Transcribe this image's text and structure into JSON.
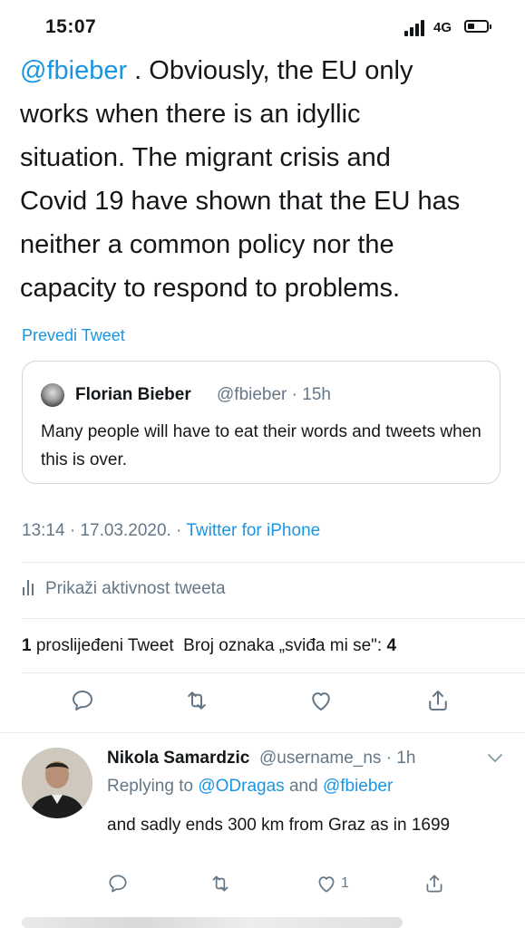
{
  "status_bar": {
    "time": "15:07",
    "network": "4G"
  },
  "tweet": {
    "mention": "@fbieber",
    "text_after_mention": " . Obviously, the EU only",
    "lines": [
      "works when there is an idyllic",
      "situation.  The migrant crisis and",
      "Covid 19 have shown that the EU has",
      "neither a common policy nor the",
      "capacity to respond to problems."
    ],
    "translate_label": "Prevedi Tweet",
    "quoted": {
      "name": "Florian Bieber",
      "handle_time": "@fbieber · 15h",
      "text": "Many people will have to eat their words and tweets when this is over."
    },
    "timestamp": "13:14 · 17.03.2020. · ",
    "source": "Twitter for iPhone",
    "activity_label": "Prikaži aktivnost tweeta",
    "retweet_count": "1",
    "retweet_label": " proslijeđeni Tweet",
    "likes_label": "Broj oznaka „sviđa mi se\": ",
    "likes_count": "4"
  },
  "reply": {
    "name": "Nikola Samardzic",
    "handle_time": "@username_ns · 1h",
    "replying_prefix": "Replying to ",
    "replying_to_1": "@ODragas",
    "replying_and": " and ",
    "replying_to_2": "@fbieber",
    "text": "and sadly ends 300 km from Graz as in 1699",
    "like_count": "1"
  },
  "colors": {
    "accent": "#1b95e0",
    "muted": "#657786",
    "text": "#14171a",
    "border": "#e6ecf0"
  },
  "icons": [
    "signal-icon",
    "battery-icon",
    "reply-icon",
    "retweet-icon",
    "like-icon",
    "share-icon",
    "analytics-icon",
    "chevron-down-icon"
  ]
}
